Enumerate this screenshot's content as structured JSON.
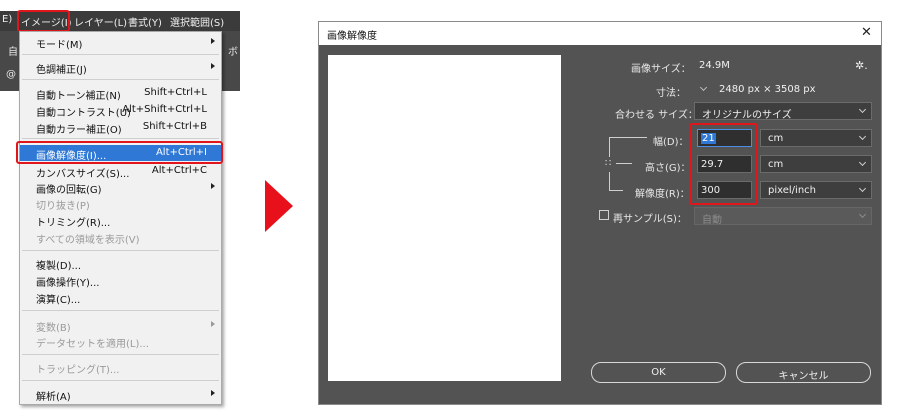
{
  "menubar": {
    "items": [
      "E)",
      "イメージ(I)",
      "レイヤー(L)",
      "書式(Y)",
      "選択範囲(S)"
    ],
    "behind_text": [
      "自",
      "ボ",
      "@"
    ]
  },
  "image_menu": {
    "items": [
      {
        "label": "モード(M)",
        "shortcut": "",
        "submenu": true,
        "disabled": false
      },
      {
        "label": "色調補正(J)",
        "shortcut": "",
        "submenu": true,
        "disabled": false
      },
      {
        "label": "自動トーン補正(N)",
        "shortcut": "Shift+Ctrl+L",
        "submenu": false,
        "disabled": false
      },
      {
        "label": "自動コントラスト(U)",
        "shortcut": "Alt+Shift+Ctrl+L",
        "submenu": false,
        "disabled": false
      },
      {
        "label": "自動カラー補正(O)",
        "shortcut": "Shift+Ctrl+B",
        "submenu": false,
        "disabled": false
      },
      {
        "label": "画像解像度(I)...",
        "shortcut": "Alt+Ctrl+I",
        "submenu": false,
        "disabled": false,
        "highlighted": true
      },
      {
        "label": "カンバスサイズ(S)...",
        "shortcut": "Alt+Ctrl+C",
        "submenu": false,
        "disabled": false
      },
      {
        "label": "画像の回転(G)",
        "shortcut": "",
        "submenu": true,
        "disabled": false
      },
      {
        "label": "切り抜き(P)",
        "shortcut": "",
        "submenu": false,
        "disabled": true
      },
      {
        "label": "トリミング(R)...",
        "shortcut": "",
        "submenu": false,
        "disabled": false
      },
      {
        "label": "すべての領域を表示(V)",
        "shortcut": "",
        "submenu": false,
        "disabled": true
      },
      {
        "label": "複製(D)...",
        "shortcut": "",
        "submenu": false,
        "disabled": false
      },
      {
        "label": "画像操作(Y)...",
        "shortcut": "",
        "submenu": false,
        "disabled": false
      },
      {
        "label": "演算(C)...",
        "shortcut": "",
        "submenu": false,
        "disabled": false
      },
      {
        "label": "変数(B)",
        "shortcut": "",
        "submenu": true,
        "disabled": true
      },
      {
        "label": "データセットを適用(L)...",
        "shortcut": "",
        "submenu": false,
        "disabled": true
      },
      {
        "label": "トラッピング(T)...",
        "shortcut": "",
        "submenu": false,
        "disabled": true
      },
      {
        "label": "解析(A)",
        "shortcut": "",
        "submenu": true,
        "disabled": false
      }
    ]
  },
  "dialog": {
    "title": "画像解像度",
    "close_glyph": "✕",
    "gear_glyph": "✲.",
    "image_size_label": "画像サイズ：",
    "image_size_value": "24.9M",
    "dimensions_label": "寸法：",
    "dimensions_value": "2480 px × 3508 px",
    "fit_to_label": "合わせる サイズ：",
    "fit_to_value": "オリジナルのサイズ",
    "width_label": "幅(D)：",
    "width_value": "21",
    "width_unit": "cm",
    "height_label": "高さ(G)：",
    "height_value": "29.7",
    "height_unit": "cm",
    "resolution_label": "解像度(R)：",
    "resolution_value": "300",
    "resolution_unit": "pixel/inch",
    "resample_label": "再サンプル(S)：",
    "resample_value": "自動",
    "resample_checked": false,
    "ok_label": "OK",
    "cancel_label": "キャンセル"
  },
  "colors": {
    "highlight": "#2f78d6",
    "callout_red": "#e0161c",
    "dialog_bg": "#535353",
    "menubar_bg": "#3b3b3b"
  }
}
